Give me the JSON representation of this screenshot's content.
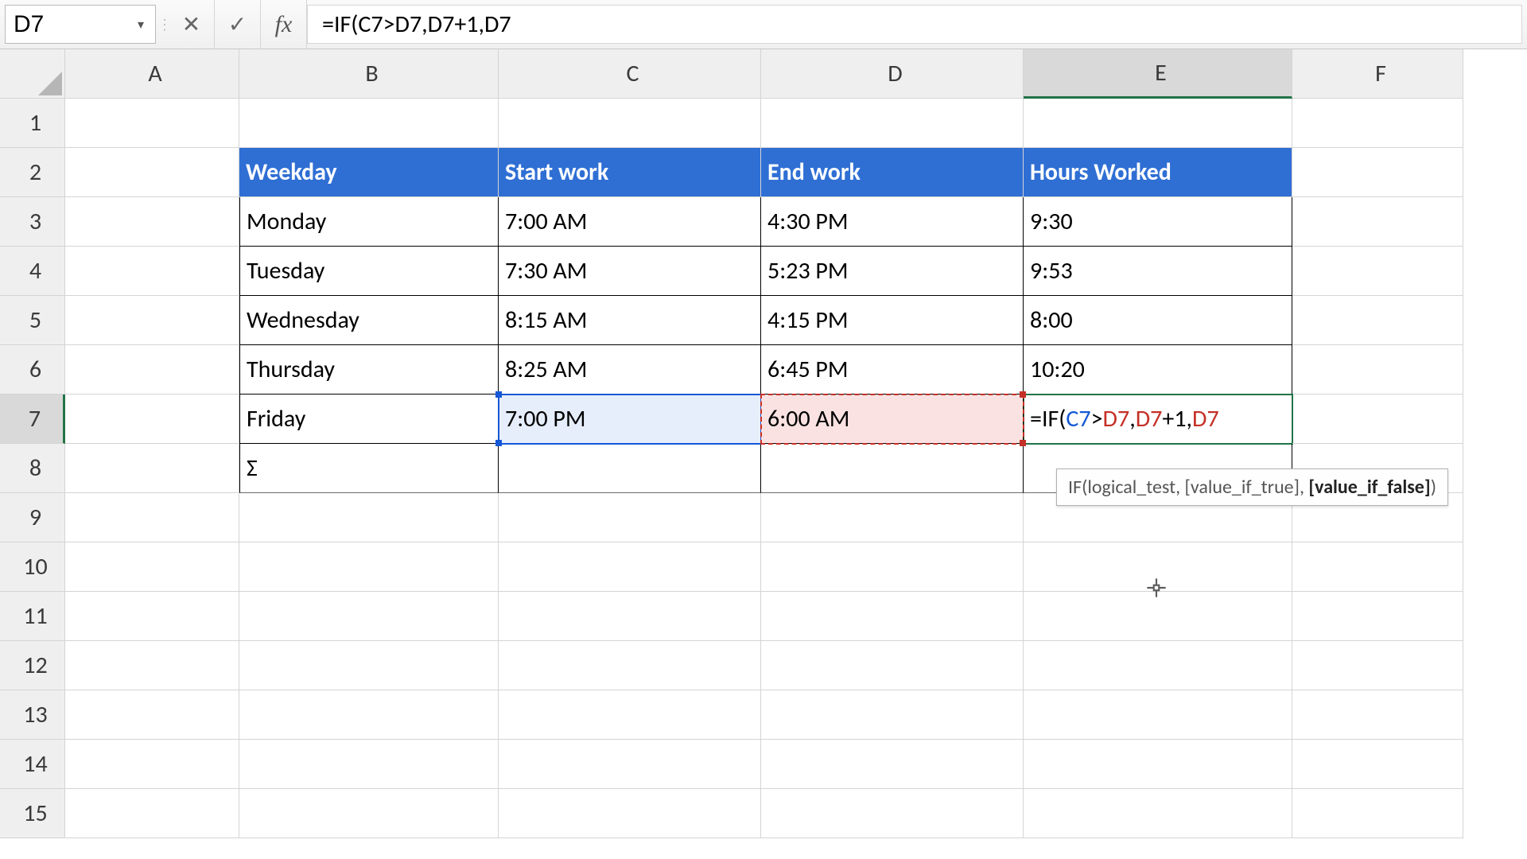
{
  "namebox": {
    "value": "D7"
  },
  "formula_bar": {
    "cancel_glyph": "✕",
    "enter_glyph": "✓",
    "fx_glyph": "fx",
    "formula_text": "=IF(C7>D7,D7+1,D7"
  },
  "columns": [
    "A",
    "B",
    "C",
    "D",
    "E",
    "F"
  ],
  "row_numbers": [
    "1",
    "2",
    "3",
    "4",
    "5",
    "6",
    "7",
    "8",
    "9",
    "10",
    "11",
    "12",
    "13",
    "14",
    "15"
  ],
  "active_col": "E",
  "active_row": "7",
  "table": {
    "headers": {
      "B": "Weekday",
      "C": "Start work",
      "D": "End work",
      "E": "Hours Worked"
    },
    "rows": [
      {
        "B": "Monday",
        "C": "7:00 AM",
        "D": "4:30 PM",
        "E": "9:30"
      },
      {
        "B": "Tuesday",
        "C": "7:30 AM",
        "D": "5:23 PM",
        "E": "9:53"
      },
      {
        "B": "Wednesday",
        "C": "8:15 AM",
        "D": "4:15 PM",
        "E": "8:00"
      },
      {
        "B": "Thursday",
        "C": "8:25 AM",
        "D": "6:45 PM",
        "E": "10:20"
      },
      {
        "B": "Friday",
        "C": "7:00 PM",
        "D": "6:00 AM",
        "E_formula": true
      }
    ],
    "sigma_row": {
      "B": "Σ"
    }
  },
  "editing_formula_tokens": [
    {
      "t": "=IF(",
      "c": "black"
    },
    {
      "t": "C7",
      "c": "blue"
    },
    {
      "t": ">",
      "c": "black"
    },
    {
      "t": "D7",
      "c": "red"
    },
    {
      "t": ",",
      "c": "black"
    },
    {
      "t": "D7",
      "c": "red"
    },
    {
      "t": "+1,",
      "c": "black"
    },
    {
      "t": "D7",
      "c": "red"
    }
  ],
  "tooltip": {
    "prefix": "IF(logical_test, [value_if_true], ",
    "active": "[value_if_false]",
    "suffix": ")"
  },
  "chart_data": {
    "type": "table",
    "title": "Hours Worked",
    "columns": [
      "Weekday",
      "Start work",
      "End work",
      "Hours Worked"
    ],
    "rows": [
      [
        "Monday",
        "7:00 AM",
        "4:30 PM",
        "9:30"
      ],
      [
        "Tuesday",
        "7:30 AM",
        "5:23 PM",
        "9:53"
      ],
      [
        "Wednesday",
        "8:15 AM",
        "4:15 PM",
        "8:00"
      ],
      [
        "Thursday",
        "8:25 AM",
        "6:45 PM",
        "10:20"
      ],
      [
        "Friday",
        "7:00 PM",
        "6:00 AM",
        "=IF(C7>D7,D7+1,D7"
      ]
    ]
  }
}
